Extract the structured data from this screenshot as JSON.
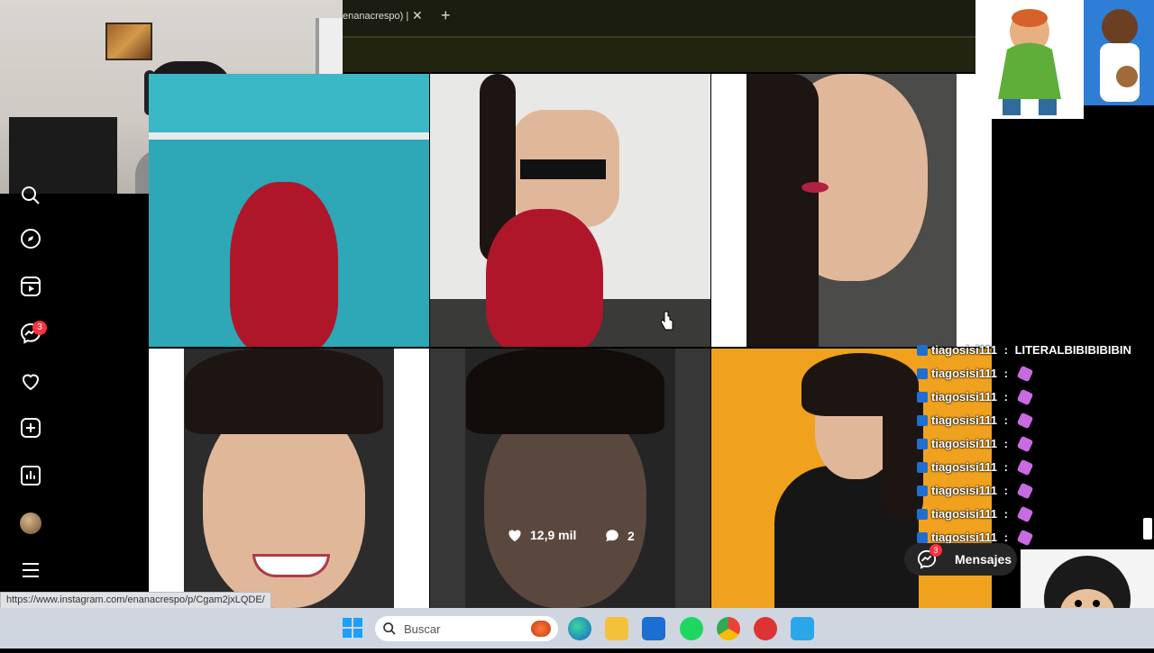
{
  "browser": {
    "tab_title": "enanacrespo) |",
    "tab_close": "✕",
    "new_tab": "+"
  },
  "sidebar": {
    "items": [
      {
        "name": "search",
        "icon": "search-icon"
      },
      {
        "name": "explore",
        "icon": "compass-icon"
      },
      {
        "name": "reels",
        "icon": "reels-icon"
      },
      {
        "name": "messages",
        "icon": "messenger-icon",
        "badge": "3"
      },
      {
        "name": "notifications",
        "icon": "heart-icon"
      },
      {
        "name": "create",
        "icon": "plus-square-icon"
      },
      {
        "name": "dashboard",
        "icon": "chart-icon"
      },
      {
        "name": "profile",
        "icon": "avatar"
      },
      {
        "name": "more",
        "icon": "hamburger-icon"
      }
    ]
  },
  "grid": {
    "hovered_post": {
      "likes": "12,9 mil",
      "comments": "2"
    }
  },
  "chat": {
    "lines": [
      {
        "user": "tiagosisi111",
        "message": "LITERALBIBIBIBIBIN"
      },
      {
        "user": "tiagosisi111",
        "message": ""
      },
      {
        "user": "tiagosisi111",
        "message": ""
      },
      {
        "user": "tiagosisi111",
        "message": ""
      },
      {
        "user": "tiagosisi111",
        "message": ""
      },
      {
        "user": "tiagosisi111",
        "message": ""
      },
      {
        "user": "tiagosisi111",
        "message": ""
      },
      {
        "user": "tiagosisi111",
        "message": ""
      },
      {
        "user": "tiagosisi111",
        "message": ""
      }
    ],
    "separator": " : "
  },
  "messages_button": {
    "label": "Mensajes",
    "badge": "3"
  },
  "status_url": "https://www.instagram.com/enanacrespo/p/Cgam2jxLQDE/",
  "taskbar": {
    "search_placeholder": "Buscar"
  },
  "colors": {
    "instagram_bg": "#000000",
    "badge_red": "#ff3040",
    "taskbar_bg": "#cfd6e0",
    "chat_badge_blue": "#1f6fd1"
  }
}
